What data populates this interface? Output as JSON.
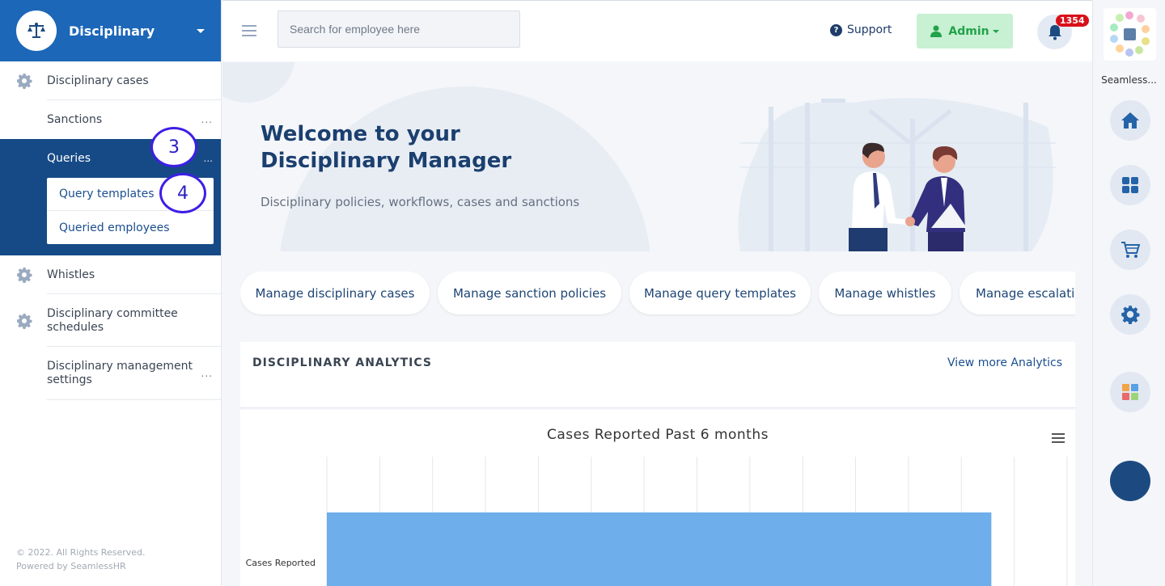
{
  "sidebar": {
    "module_title": "Disciplinary",
    "items": [
      {
        "label": "Disciplinary cases"
      },
      {
        "label": "Sanctions",
        "more": "..."
      },
      {
        "label": "Queries",
        "more": "..."
      },
      {
        "label": "Whistles"
      },
      {
        "label": "Disciplinary committee schedules"
      },
      {
        "label": "Disciplinary management settings",
        "more": "..."
      }
    ],
    "submenu": [
      {
        "label": "Query templates"
      },
      {
        "label": "Queried employees"
      }
    ],
    "annotations": [
      "3",
      "4"
    ],
    "footer": {
      "copyright": "© 2022. All Rights Reserved.",
      "powered_by": "Powered by SeamlessHR"
    }
  },
  "header": {
    "search_placeholder": "Search for employee here",
    "support_label": "Support",
    "admin_label": "Admin",
    "notification_count": "1354"
  },
  "hero": {
    "title": "Welcome to your Disciplinary Manager",
    "subtitle": "Disciplinary policies, workflows, cases and sanctions"
  },
  "quick_links": [
    "Manage disciplinary cases",
    "Manage sanction policies",
    "Manage query templates",
    "Manage whistles",
    "Manage escalations"
  ],
  "analytics": {
    "section_title": "DISCIPLINARY ANALYTICS",
    "more_link": "View more Analytics"
  },
  "chart_data": {
    "type": "bar",
    "title": "Cases Reported Past 6 months",
    "categories": [
      "Cases Reported"
    ],
    "series": [
      {
        "values": [
          1
        ]
      }
    ],
    "colors": {
      "bar": "#6eaeeb",
      "grid": "#e6e6e6"
    }
  },
  "rail": {
    "app_name": "Seamless...",
    "buttons": [
      "home-icon",
      "dashboard-icon",
      "cart-icon",
      "settings-icon",
      "apps-icon"
    ]
  },
  "colors": {
    "brand": "#1c67b8",
    "active_nav": "#164a86",
    "admin_bg": "#c8f0d2",
    "badge": "#d9101a"
  }
}
